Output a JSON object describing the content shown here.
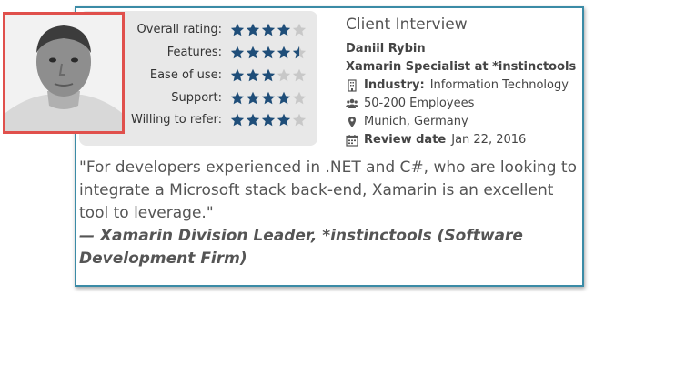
{
  "review": {
    "ratings": [
      {
        "label": "Overall rating:",
        "score": 4,
        "max": 5
      },
      {
        "label": "Features:",
        "score": 4.5,
        "max": 5
      },
      {
        "label": "Ease of use:",
        "score": 3,
        "max": 5
      },
      {
        "label": "Support:",
        "score": 4,
        "max": 5
      },
      {
        "label": "Willing to refer:",
        "score": 4,
        "max": 5
      }
    ],
    "star_color": "#1f4e79",
    "empty_star_color": "#c8c8c8",
    "border_color": "#3b8ba6",
    "photo_border_color": "#e0504c",
    "heading": "Client Interview",
    "name": "Daniil Rybin",
    "position": "Xamarin Specialist at *instinctools",
    "industry_label": "Industry:",
    "industry": "Information Technology",
    "employees": "50-200 Employees",
    "location": "Munich, Germany",
    "review_date_label": "Review date",
    "review_date": "Jan 22, 2016",
    "quote": "\"For developers experienced in .NET and C#, who are looking to integrate a Microsoft stack back-end, Xamarin is an excellent tool to leverage.\"",
    "attribution": "— Xamarin Division Leader, *instinctools (Software Development Firm)",
    "icons": {
      "industry": "building-icon",
      "employees": "users-icon",
      "location": "map-marker-icon",
      "date": "calendar-icon"
    }
  }
}
